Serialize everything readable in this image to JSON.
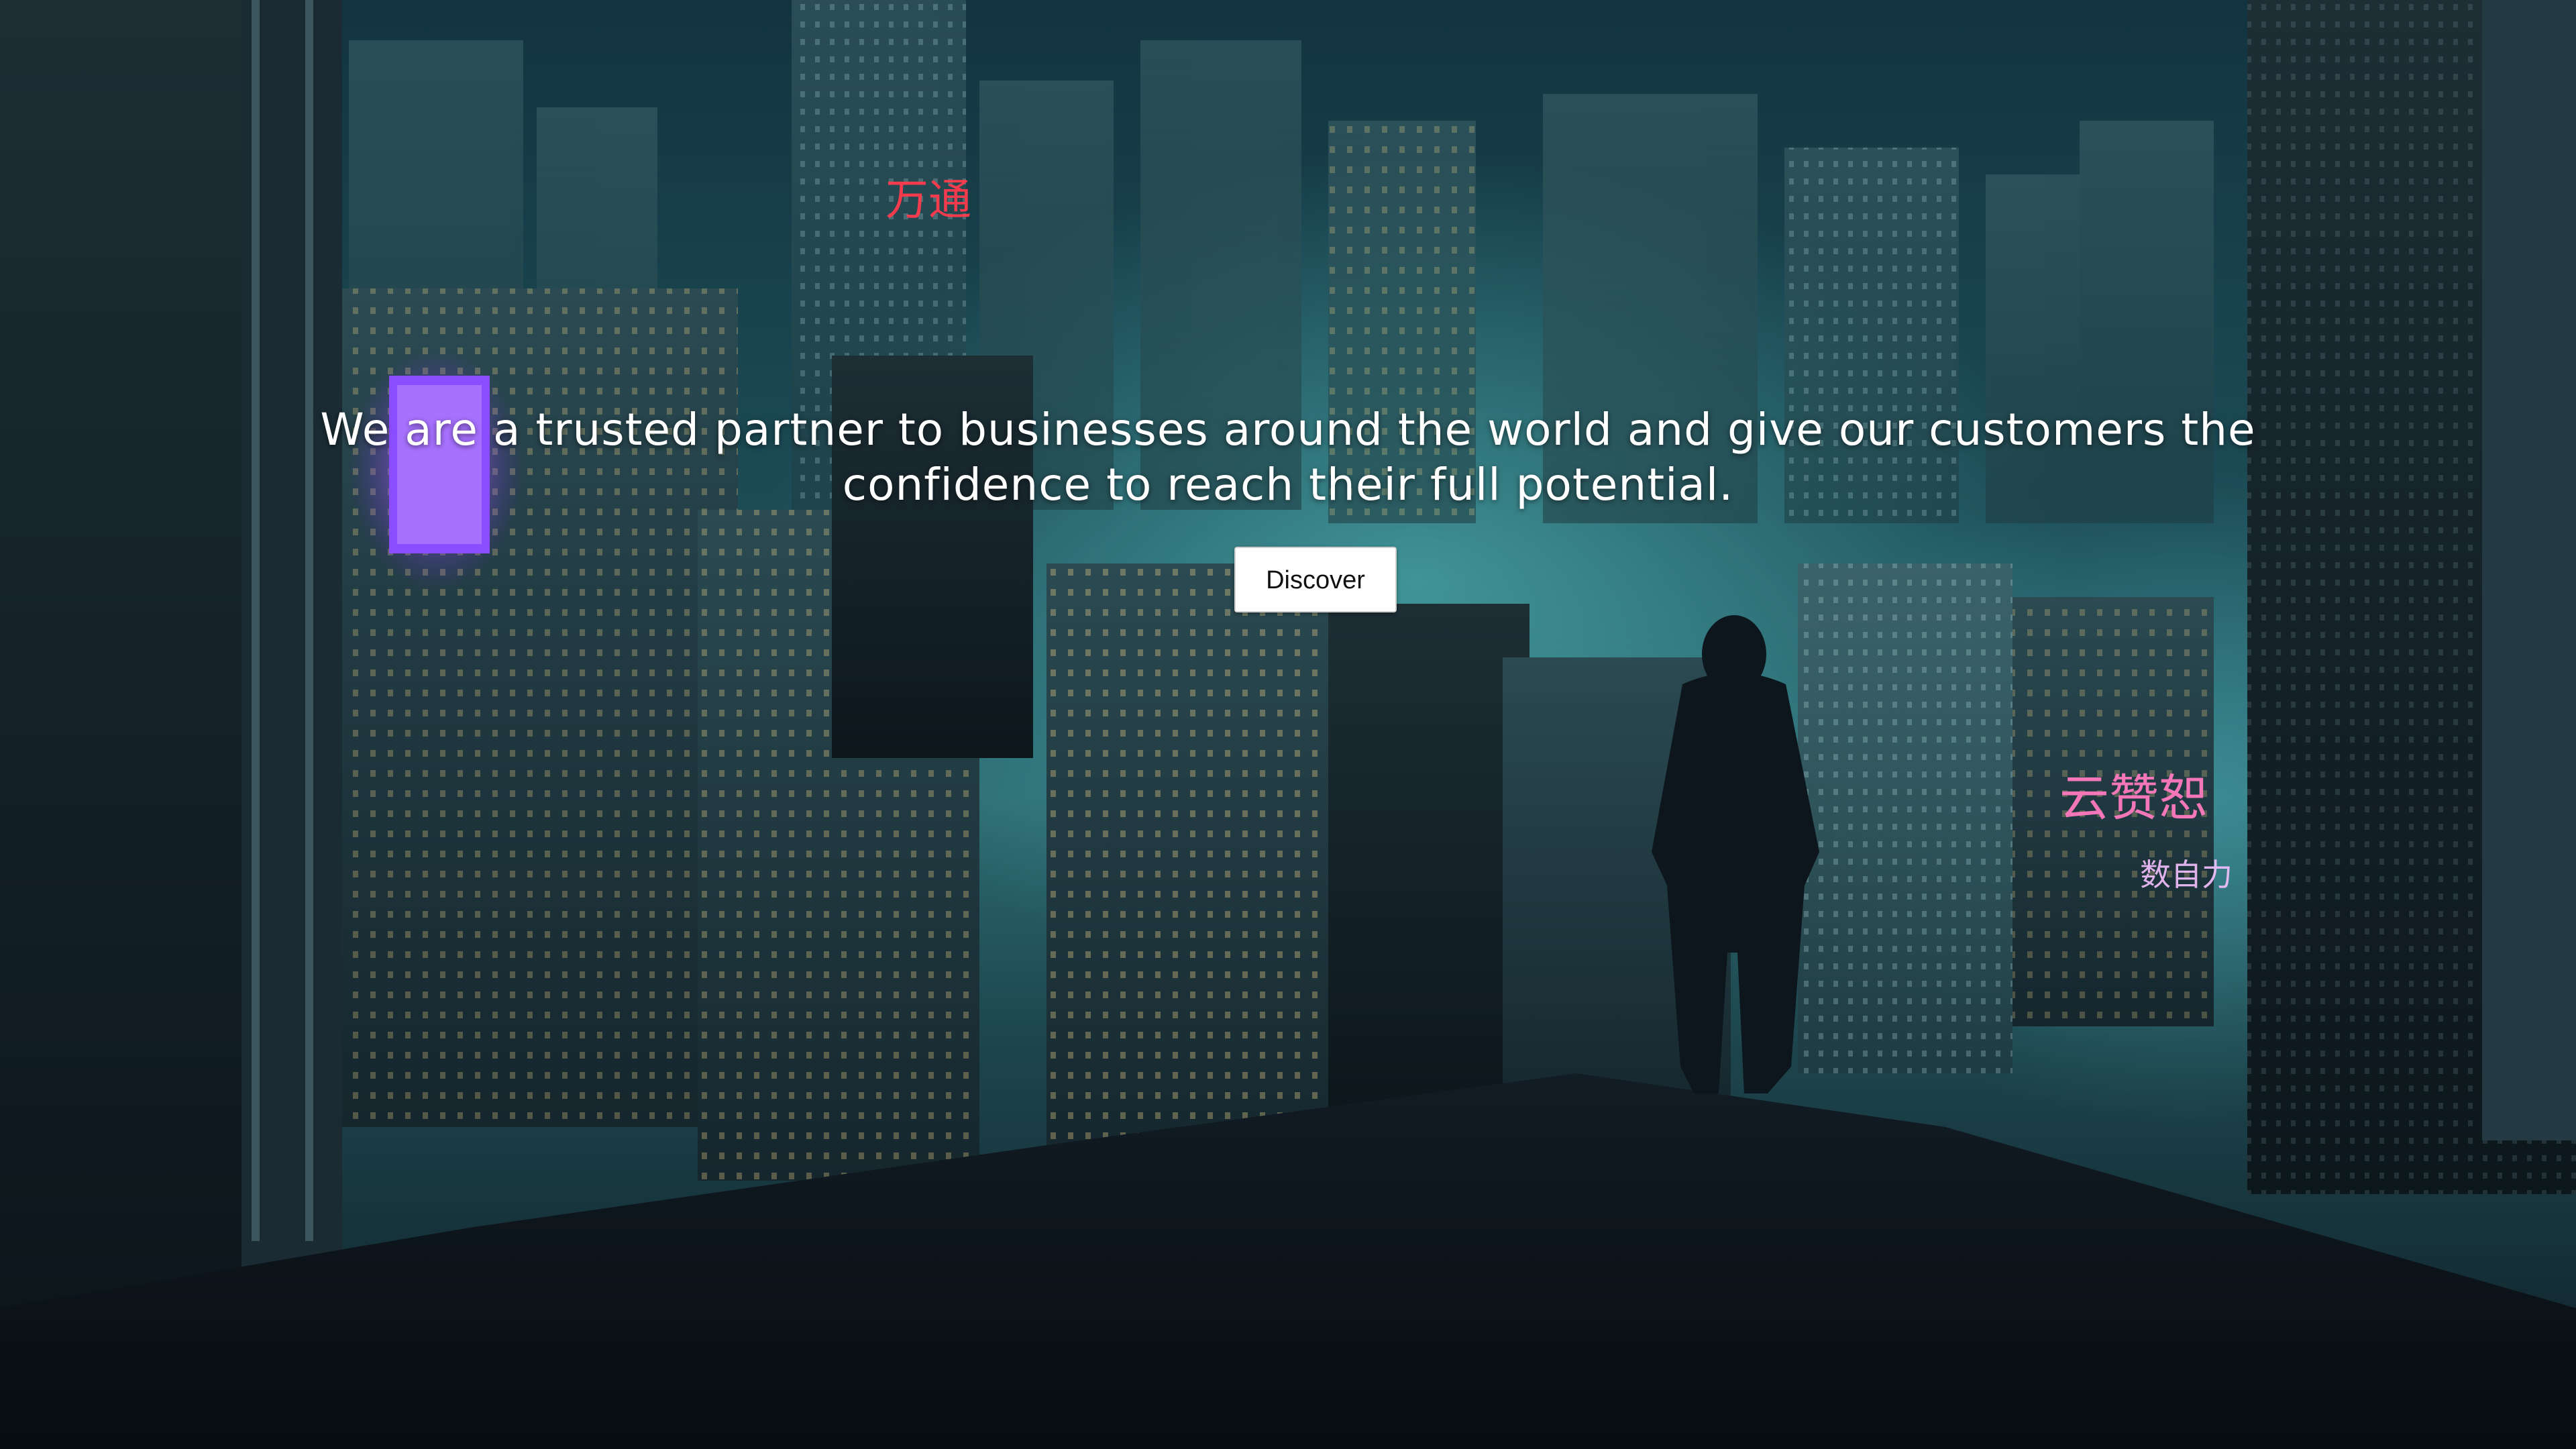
{
  "hero": {
    "headline_line1": "We are a trusted partner to businesses around the world and give our customers the",
    "headline_line2": "confidence to reach their full potential.",
    "cta_label": "Discover"
  },
  "background": {
    "scene": "cyberpunk city skyline at night with hooded figure on rooftop",
    "palette": {
      "sky": "#123440",
      "glow": "#5ac8c8",
      "rooftop": "#0b141b",
      "neon_pink": "#ff4fa3",
      "neon_red": "#ff3b4d",
      "neon_purple": "#9b4dff"
    },
    "signs": [
      "万通",
      "云赞恕",
      "数自力"
    ]
  }
}
